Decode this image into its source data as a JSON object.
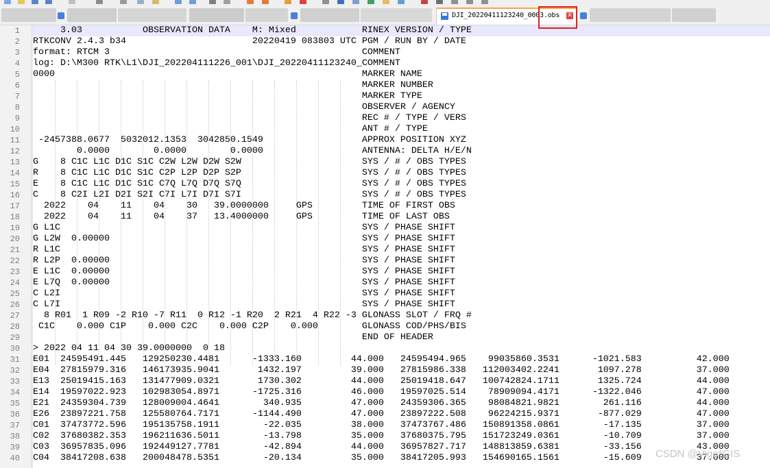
{
  "colors": {
    "accent_tab_top": "#f7a74a",
    "highlight_box": "#e02020",
    "current_line": "#e8e8ff",
    "line_number": "#808080"
  },
  "icons": {
    "tab_file": "save-icon",
    "tab_close": "close-icon"
  },
  "tab": {
    "label": "DJI_20220411123240_0003.obs",
    "close_glyph": "✕"
  },
  "editor": {
    "lines": [
      {
        "n": "1",
        "text": "     3.03           OBSERVATION DATA    M: Mixed            RINEX VERSION / TYPE"
      },
      {
        "n": "2",
        "text": "RTKCONV 2.4.3 b34                       20220419 083803 UTC PGM / RUN BY / DATE"
      },
      {
        "n": "3",
        "text": "format: RTCM 3                                              COMMENT"
      },
      {
        "n": "4",
        "text": "log: D:\\M300 RTK\\L1\\DJI_202204111226_001\\DJI_20220411123240_COMMENT"
      },
      {
        "n": "5",
        "text": "0000                                                        MARKER NAME"
      },
      {
        "n": "6",
        "text": "                                                            MARKER NUMBER"
      },
      {
        "n": "7",
        "text": "                                                            MARKER TYPE"
      },
      {
        "n": "8",
        "text": "                                                            OBSERVER / AGENCY"
      },
      {
        "n": "9",
        "text": "                                                            REC # / TYPE / VERS"
      },
      {
        "n": "10",
        "text": "                                                            ANT # / TYPE"
      },
      {
        "n": "11",
        "text": " -2457388.0677  5032012.1353  3042850.1549                  APPROX POSITION XYZ"
      },
      {
        "n": "12",
        "text": "        0.0000        0.0000        0.0000                  ANTENNA: DELTA H/E/N"
      },
      {
        "n": "13",
        "text": "G    8 C1C L1C D1C S1C C2W L2W D2W S2W                      SYS / # / OBS TYPES"
      },
      {
        "n": "14",
        "text": "R    8 C1C L1C D1C S1C C2P L2P D2P S2P                      SYS / # / OBS TYPES"
      },
      {
        "n": "15",
        "text": "E    8 C1C L1C D1C S1C C7Q L7Q D7Q S7Q                      SYS / # / OBS TYPES"
      },
      {
        "n": "16",
        "text": "C    8 C2I L2I D2I S2I C7I L7I D7I S7I                      SYS / # / OBS TYPES"
      },
      {
        "n": "17",
        "text": "  2022    04    11    04    30   39.0000000     GPS         TIME OF FIRST OBS"
      },
      {
        "n": "18",
        "text": "  2022    04    11    04    37   13.4000000     GPS         TIME OF LAST OBS"
      },
      {
        "n": "19",
        "text": "G L1C                                                       SYS / PHASE SHIFT"
      },
      {
        "n": "20",
        "text": "G L2W  0.00000                                              SYS / PHASE SHIFT"
      },
      {
        "n": "21",
        "text": "R L1C                                                       SYS / PHASE SHIFT"
      },
      {
        "n": "22",
        "text": "R L2P  0.00000                                              SYS / PHASE SHIFT"
      },
      {
        "n": "23",
        "text": "E L1C  0.00000                                              SYS / PHASE SHIFT"
      },
      {
        "n": "24",
        "text": "E L7Q  0.00000                                              SYS / PHASE SHIFT"
      },
      {
        "n": "25",
        "text": "C L2I                                                       SYS / PHASE SHIFT"
      },
      {
        "n": "26",
        "text": "C L7I                                                       SYS / PHASE SHIFT"
      },
      {
        "n": "27",
        "text": "  8 R01  1 R09 -2 R10 -7 R11  0 R12 -1 R20  2 R21  4 R22 -3 GLONASS SLOT / FRQ #"
      },
      {
        "n": "28",
        "text": " C1C    0.000 C1P    0.000 C2C    0.000 C2P    0.000        GLONASS COD/PHS/BIS"
      },
      {
        "n": "29",
        "text": "                                                            END OF HEADER"
      },
      {
        "n": "30",
        "text": "> 2022 04 11 04 30 39.0000000  0 18"
      },
      {
        "n": "31",
        "text": "E01  24595491.445   129250230.4481      -1333.160         44.000   24595494.965    99035860.3531      -1021.583          42.000"
      },
      {
        "n": "32",
        "text": "E04  27815979.316   146173935.9041       1432.197         39.000   27815986.338   112003402.2241       1097.278          37.000"
      },
      {
        "n": "33",
        "text": "E13  25019415.163   131477909.0321       1730.302         44.000   25019418.647   100742824.1711       1325.724          44.000"
      },
      {
        "n": "34",
        "text": "E14  19597022.923   102983054.8971      -1725.316         46.000   19597025.514    78909094.4171      -1322.046          47.000"
      },
      {
        "n": "35",
        "text": "E21  24359304.739   128009004.4641        340.935         47.000   24359306.365    98084821.9821        261.116          44.000"
      },
      {
        "n": "36",
        "text": "E26  23897221.758   125580764.7171      -1144.490         47.000   23897222.508    96224215.9371       -877.029          47.000"
      },
      {
        "n": "37",
        "text": "C01  37473772.596   195135758.1911        -22.035         38.000   37473767.486   150891358.0861        -17.135          37.000"
      },
      {
        "n": "38",
        "text": "C02  37680382.353   196211636.5011        -13.798         35.000   37680375.795   151723249.0361        -10.709          37.000"
      },
      {
        "n": "39",
        "text": "C03  36957835.096   192449127.7781        -42.894         44.000   36957827.717   148813859.6381        -33.156          43.000"
      },
      {
        "n": "40",
        "text": "C04  38417208.638   200048478.5351        -20.134         35.000   38417205.993   154690165.1561        -15.609          37.000"
      }
    ]
  },
  "watermark": {
    "text": "CSDN @Vigo*GIS"
  }
}
